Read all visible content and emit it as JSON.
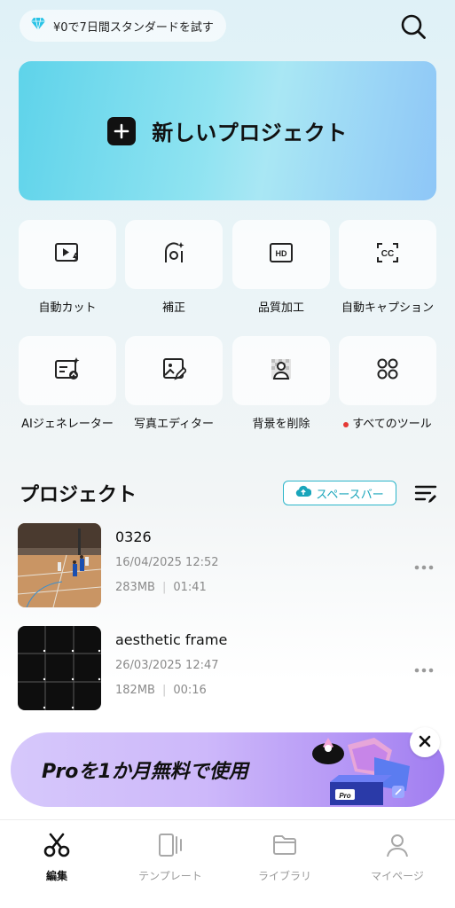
{
  "top": {
    "trial_label": "¥0で7日間スタンダードを試す",
    "icons": {
      "trial": "diamond-icon",
      "search": "search-icon"
    }
  },
  "hero": {
    "label": "新しいプロジェクト",
    "icon": "plus-icon"
  },
  "tools": [
    {
      "label": "自動カット",
      "icon": "auto-cut-icon"
    },
    {
      "label": "補正",
      "icon": "enhance-icon"
    },
    {
      "label": "品質加工",
      "icon": "hd-icon"
    },
    {
      "label": "自動キャプション",
      "icon": "caption-icon"
    },
    {
      "label": "AIジェネレーター",
      "icon": "ai-generator-icon"
    },
    {
      "label": "写真エディター",
      "icon": "photo-editor-icon"
    },
    {
      "label": "背景を削除",
      "icon": "remove-background-icon"
    },
    {
      "label": "すべてのツール",
      "icon": "all-tools-icon",
      "has_dot": true
    }
  ],
  "projects": {
    "title": "プロジェクト",
    "space_label": "スペースバー",
    "items": [
      {
        "name": "0326",
        "date": "16/04/2025 12:52",
        "size": "283MB",
        "duration": "01:41"
      },
      {
        "name": "aesthetic frame",
        "date": "26/03/2025 12:47",
        "size": "182MB",
        "duration": "00:16"
      }
    ]
  },
  "promo": {
    "label": "Proを1か月無料で使用",
    "badge": "Pro"
  },
  "nav": {
    "items": [
      {
        "label": "編集",
        "icon": "scissors-icon",
        "active": true
      },
      {
        "label": "テンプレート",
        "icon": "template-icon",
        "active": false
      },
      {
        "label": "ライブラリ",
        "icon": "folder-icon",
        "active": false
      },
      {
        "label": "マイページ",
        "icon": "profile-icon",
        "active": false
      }
    ]
  },
  "colors": {
    "accent": "#2bb5c9",
    "hero_start": "#5ed3ea",
    "hero_end": "#8ec6f7",
    "promo": "#b394f5"
  }
}
